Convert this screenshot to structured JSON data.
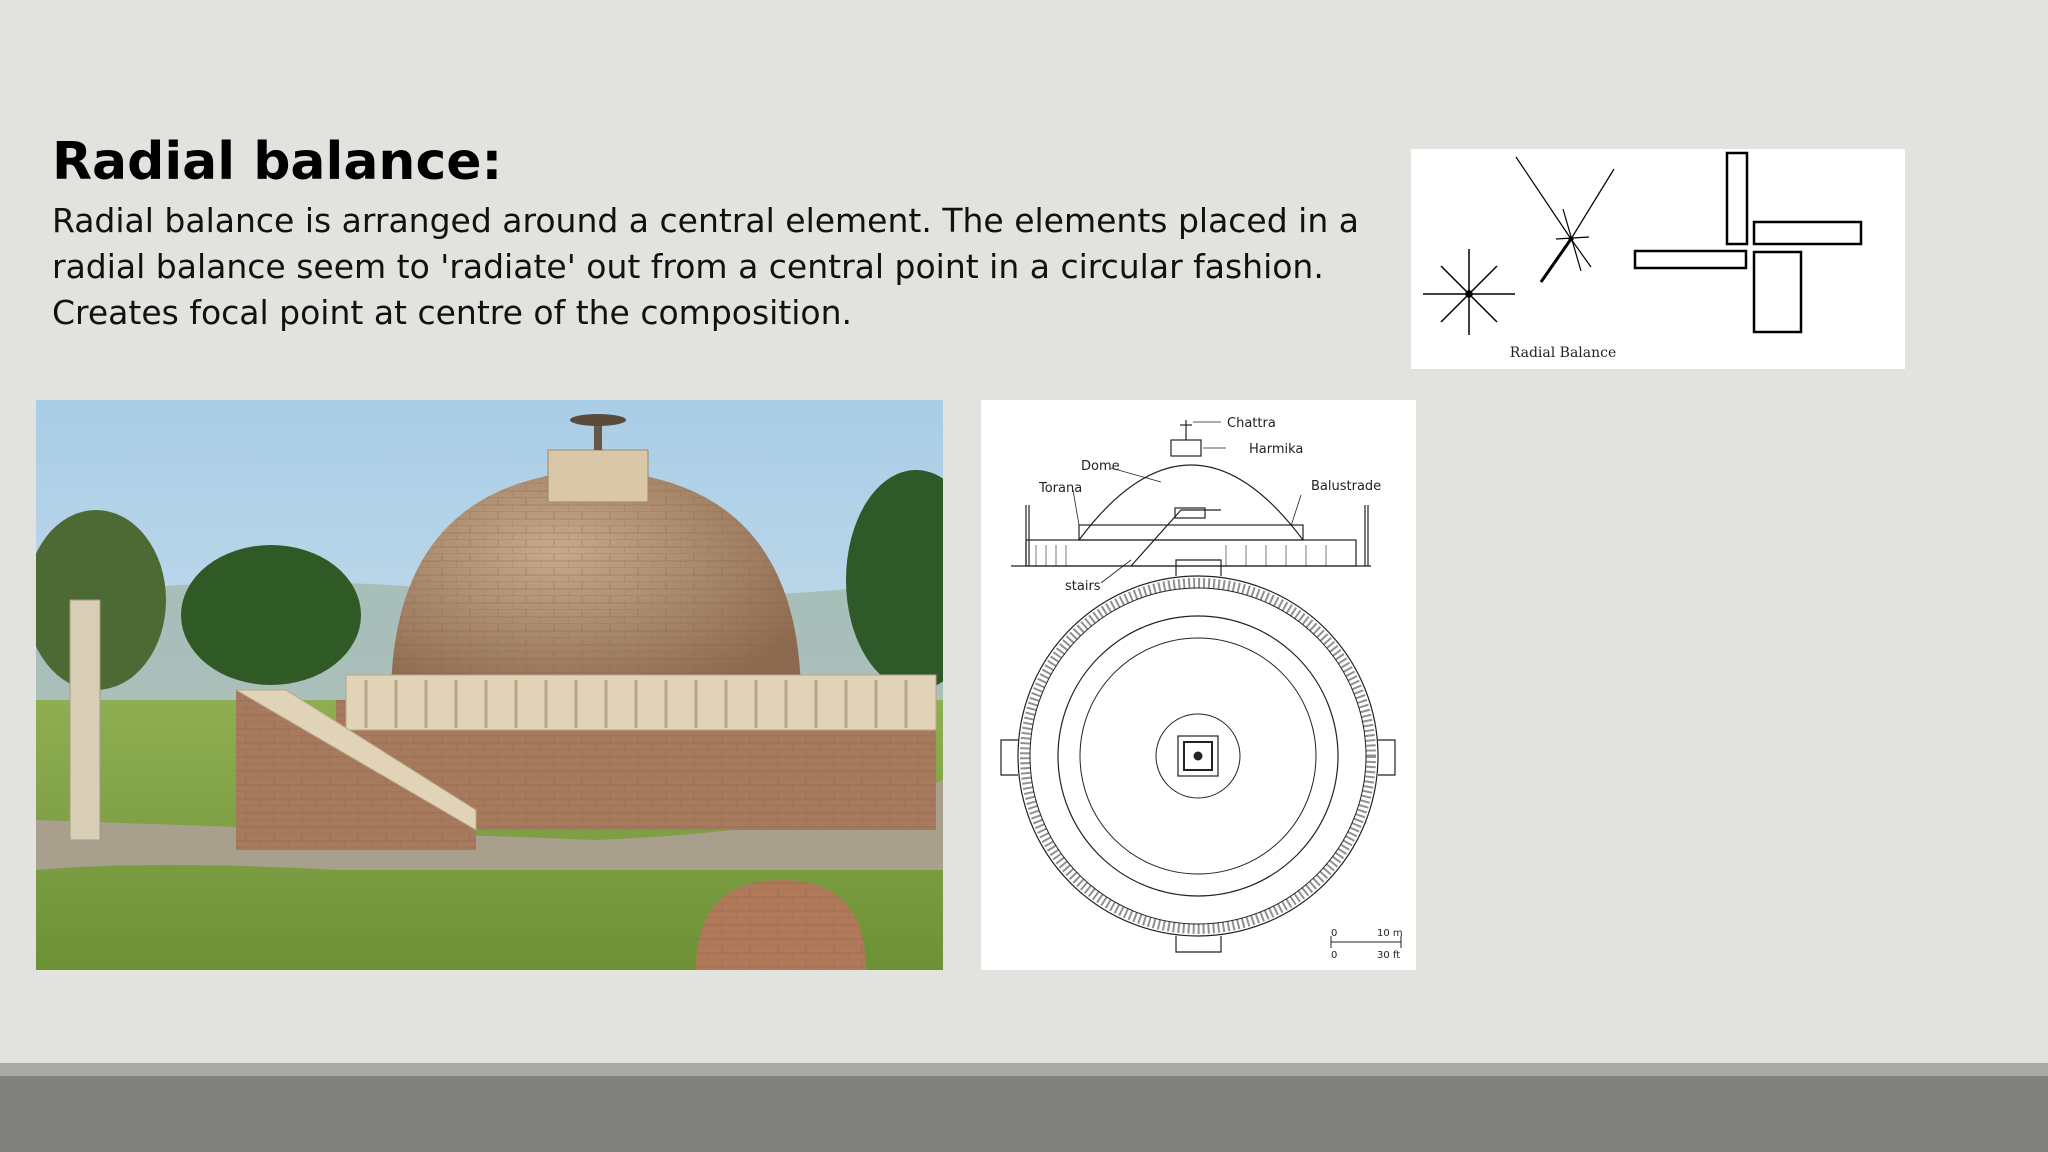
{
  "slide": {
    "title": "Radial balance:",
    "body_lines": [
      "Radial balance is arranged around a central element. The elements placed in a",
      "radial balance seem to 'radiate' out from a central point in a circular fashion.",
      "Creates focal point at centre of the composition."
    ]
  },
  "diagram": {
    "caption": "Radial Balance"
  },
  "plan": {
    "labels": {
      "chattra": "Chattra",
      "harmika": "Harmika",
      "dome": "Dome",
      "torana": "Torana",
      "balustrade": "Balustrade",
      "stairs": "stairs"
    },
    "scale": {
      "m_start": "0",
      "m_end": "10 m",
      "ft_start": "0",
      "ft_end": "30 ft"
    }
  },
  "colors": {
    "background": "#e2e2de",
    "footer_light": "#a9a9a5",
    "footer_dark": "#80807d"
  }
}
